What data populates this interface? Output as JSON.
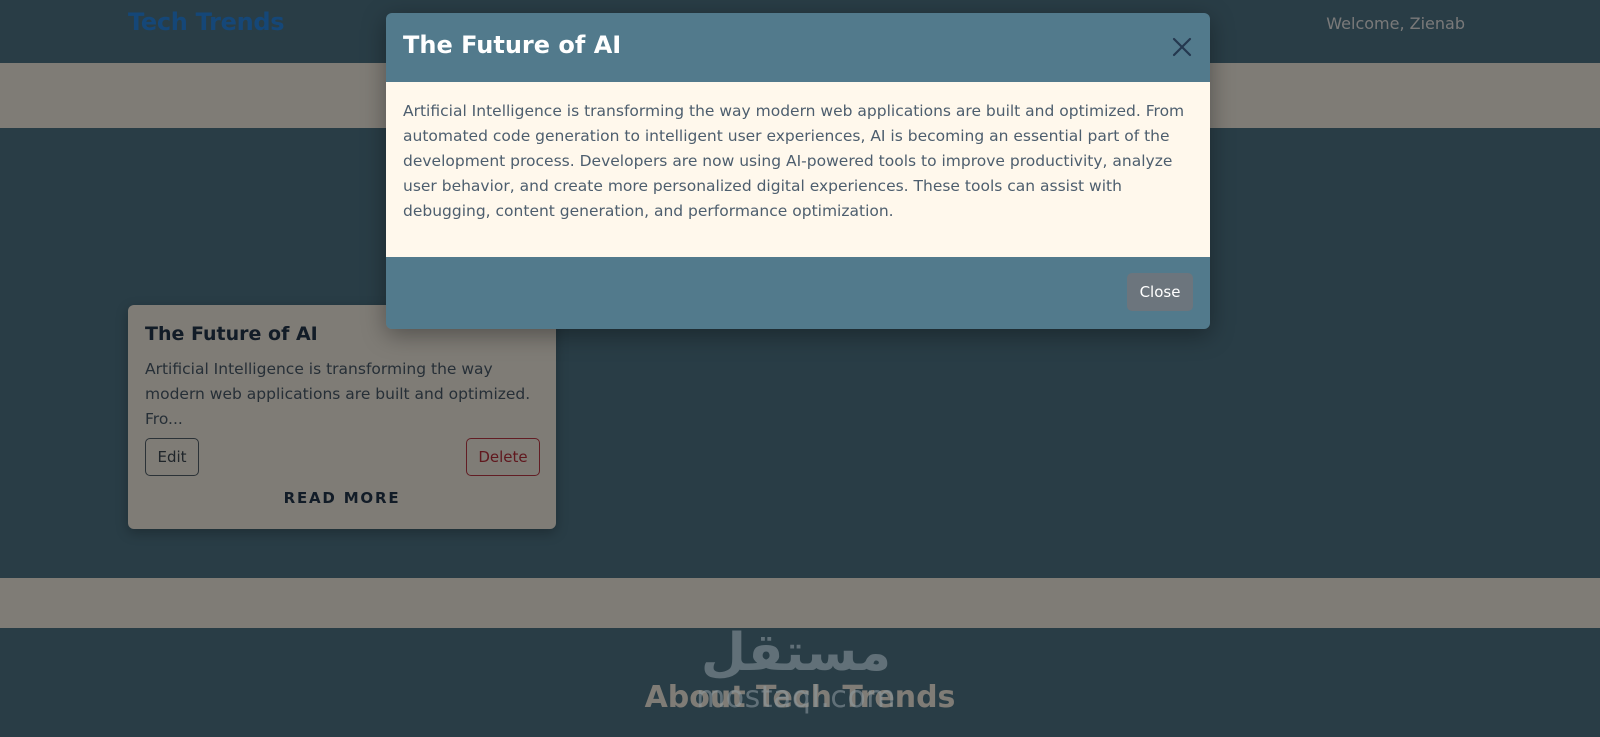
{
  "navbar": {
    "brand": "Tech Trends",
    "welcome": "Welcome, Zienab"
  },
  "post_card": {
    "title": "The Future of AI",
    "excerpt": "Artificial Intelligence is transforming the way modern web applications are built and optimized. Fro...",
    "edit_label": "Edit",
    "delete_label": "Delete",
    "read_more_label": "READ MORE"
  },
  "about": {
    "title": "About Tech Trends"
  },
  "modal": {
    "title": "The Future of AI",
    "body": "Artificial Intelligence is transforming the way modern web applications are built and optimized. From automated code generation to intelligent user experiences, AI is becoming an essential part of the development process. Developers are now using AI-powered tools to improve productivity, analyze user behavior, and create more personalized digital experiences. These tools can assist with debugging, content generation, and performance optimization.",
    "close_label": "Close",
    "close_icon": "close-icon"
  },
  "watermark": {
    "arabic": "مستقل",
    "latin": "mostaql.com"
  },
  "colors": {
    "primary_slate": "#527a8c",
    "cream": "#fff8ec",
    "brand_blue": "#2a8ff0",
    "danger": "#c0303d",
    "secondary_button": "#6c757d",
    "dark_text": "#24384f"
  }
}
